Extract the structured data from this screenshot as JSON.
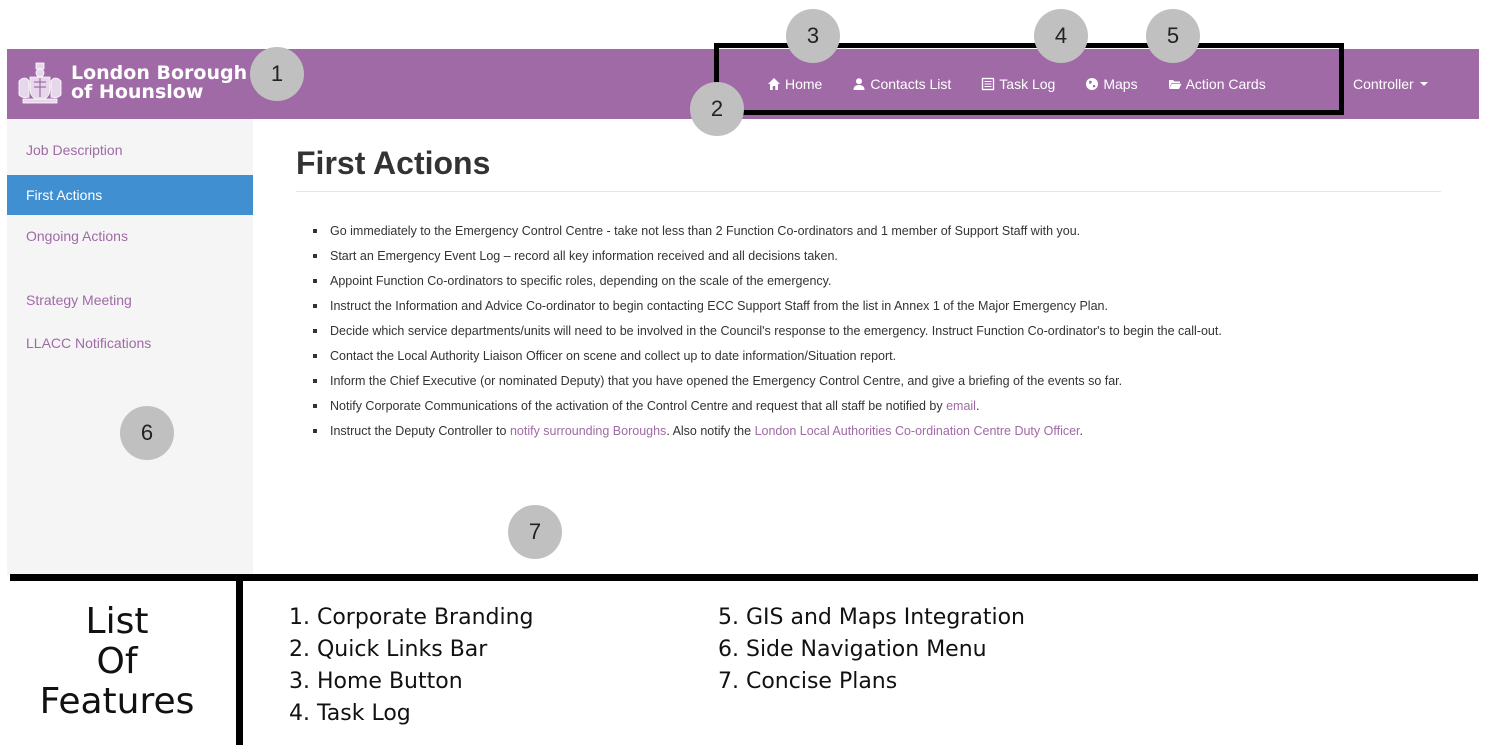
{
  "brand": {
    "line1": "London Borough",
    "line2": "of Hounslow"
  },
  "nav": {
    "links": [
      {
        "label": "Home",
        "icon": "home-icon"
      },
      {
        "label": "Contacts List",
        "icon": "user-icon"
      },
      {
        "label": "Task Log",
        "icon": "list-icon"
      },
      {
        "label": "Maps",
        "icon": "globe-icon"
      },
      {
        "label": "Action Cards",
        "icon": "folder-open-icon"
      }
    ],
    "controller": "Controller"
  },
  "sidebar": {
    "items": [
      {
        "label": "Job Description"
      },
      {
        "label": "First Actions"
      },
      {
        "label": "Ongoing Actions"
      },
      {
        "label": "Strategy Meeting"
      },
      {
        "label": "LLACC Notifications"
      }
    ]
  },
  "main": {
    "title": "First Actions",
    "actions": [
      "Go immediately to the Emergency Control Centre - take not less than 2 Function Co-ordinators and 1 member of Support Staff with you.",
      "Start an Emergency Event Log – record all key information received and all decisions taken.",
      "Appoint Function Co-ordinators to specific roles, depending on the scale of the emergency.",
      "Instruct the Information and Advice Co-ordinator to begin contacting ECC Support Staff from the list in Annex 1 of the Major Emergency Plan.",
      "Decide which service departments/units will need to be involved in the Council's response to the emergency. Instruct Function Co-ordinator's to begin the call-out.",
      "Contact the Local Authority Liaison Officer on scene and collect up to date information/Situation report.",
      "Inform the Chief Executive (or nominated Deputy) that you have opened the Emergency Control Centre, and give a briefing of the events so far."
    ],
    "action8": {
      "text": "Notify Corporate Communications of the activation of the Control Centre and request that all staff be notified by ",
      "link": "email",
      "end": "."
    },
    "action9": {
      "text1": "Instruct the Deputy Controller to ",
      "link1": "notify surrounding Boroughs",
      "text2": ". Also notify the ",
      "link2": "London Local Authorities Co-ordination Centre Duty Officer",
      "end": "."
    }
  },
  "callouts": [
    "1",
    "2",
    "3",
    "4",
    "5",
    "6",
    "7"
  ],
  "features": {
    "title": [
      "List",
      "Of",
      "Features"
    ],
    "col1": [
      "1. Corporate Branding",
      "2. Quick Links Bar",
      "3. Home Button",
      "4. Task Log"
    ],
    "col2": [
      "5. GIS and Maps Integration",
      "6. Side Navigation Menu",
      "7. Concise Plans"
    ]
  },
  "colors": {
    "brand_purple": "#a06aa6",
    "active_blue": "#3f8fd1",
    "sidebar_bg": "#f5f5f5",
    "callout_gray": "#c0c0c0"
  }
}
